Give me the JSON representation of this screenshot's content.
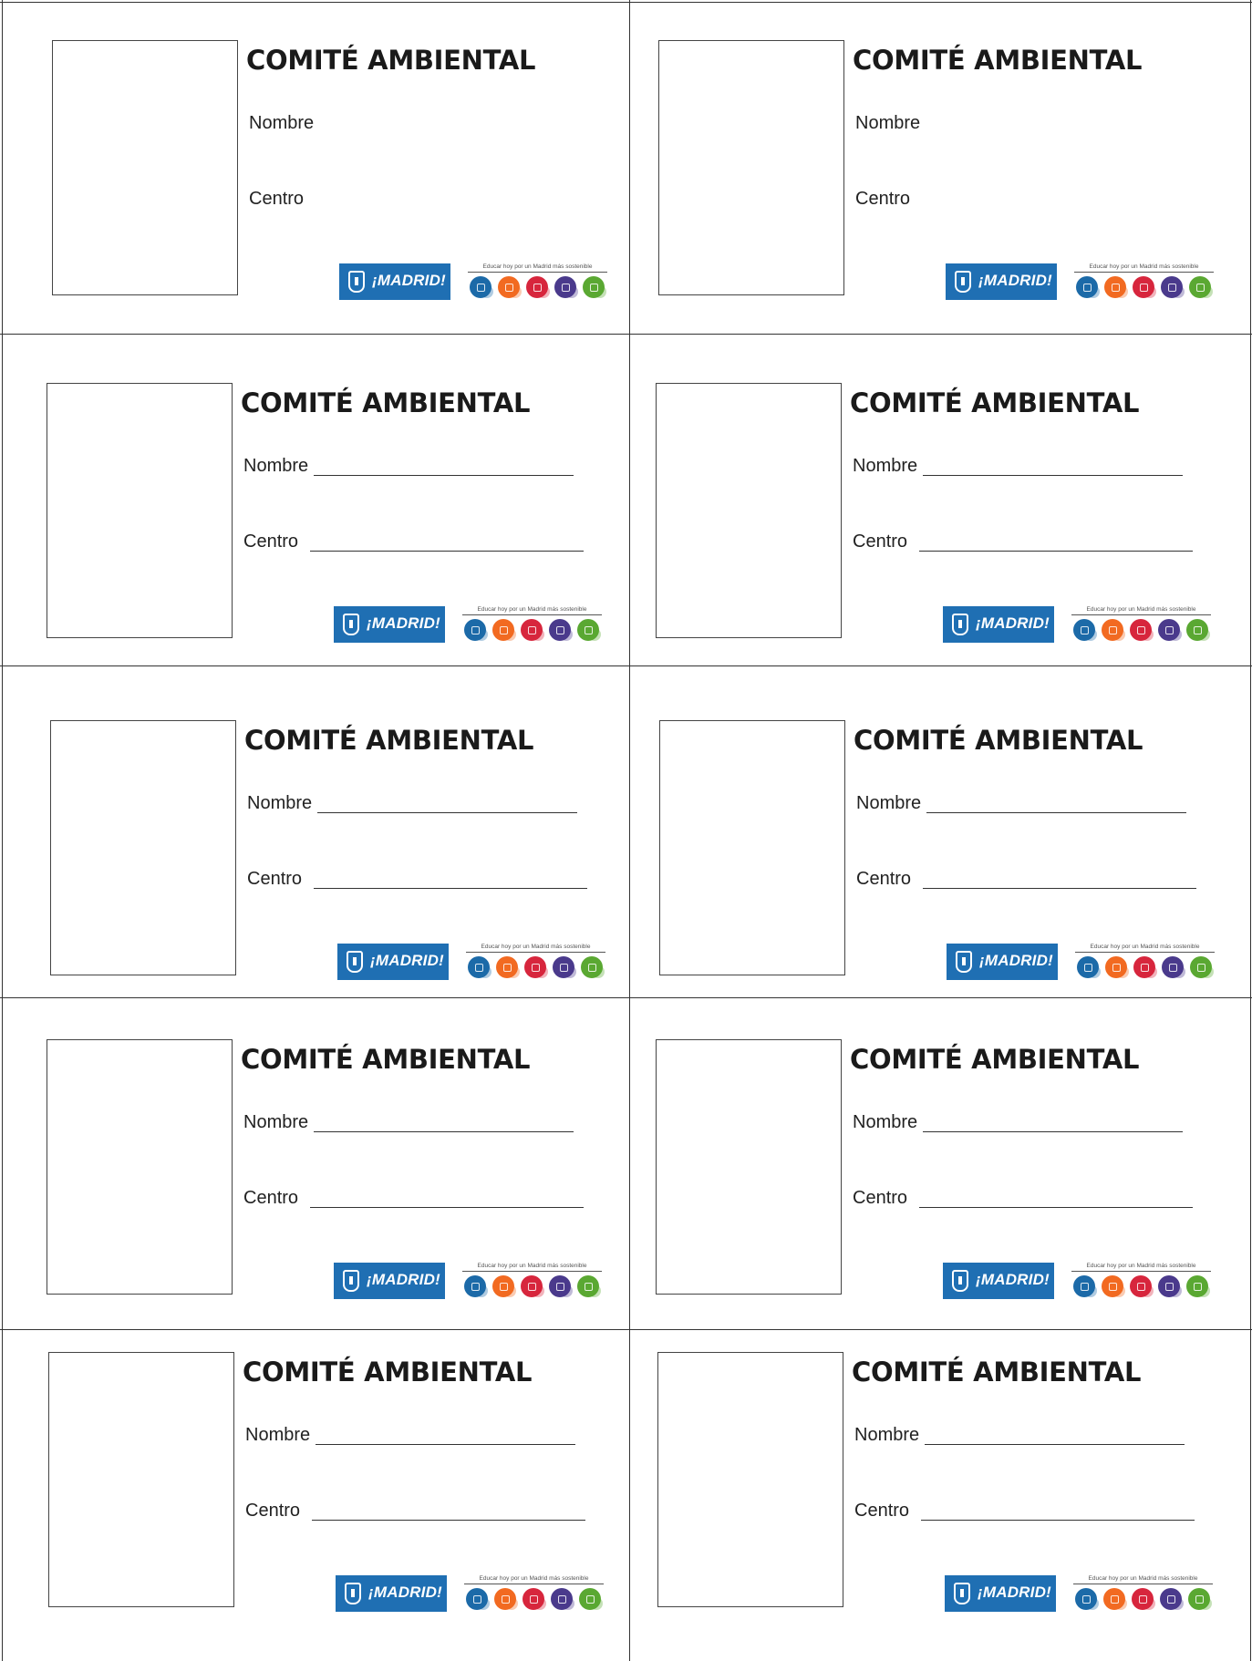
{
  "document": {
    "cards": [
      {
        "title": "COMITÉ AMBIENTAL",
        "name_label": "Nombre",
        "center_label": "Centro",
        "has_lines": false,
        "logo_text": "¡MADRID!",
        "tagline": "Educar hoy por un Madrid más sostenible"
      },
      {
        "title": "COMITÉ AMBIENTAL",
        "name_label": "Nombre",
        "center_label": "Centro",
        "has_lines": false,
        "logo_text": "¡MADRID!",
        "tagline": "Educar hoy por un Madrid más sostenible"
      },
      {
        "title": "COMITÉ AMBIENTAL",
        "name_label": "Nombre",
        "center_label": "Centro",
        "has_lines": true,
        "logo_text": "¡MADRID!",
        "tagline": "Educar hoy por un Madrid más sostenible"
      },
      {
        "title": "COMITÉ AMBIENTAL",
        "name_label": "Nombre",
        "center_label": "Centro",
        "has_lines": true,
        "logo_text": "¡MADRID!",
        "tagline": "Educar hoy por un Madrid más sostenible"
      },
      {
        "title": "COMITÉ AMBIENTAL",
        "name_label": "Nombre",
        "center_label": "Centro",
        "has_lines": true,
        "logo_text": "¡MADRID!",
        "tagline": "Educar hoy por un Madrid más sostenible"
      },
      {
        "title": "COMITÉ AMBIENTAL",
        "name_label": "Nombre",
        "center_label": "Centro",
        "has_lines": true,
        "logo_text": "¡MADRID!",
        "tagline": "Educar hoy por un Madrid más sostenible"
      },
      {
        "title": "COMITÉ AMBIENTAL",
        "name_label": "Nombre",
        "center_label": "Centro",
        "has_lines": true,
        "logo_text": "¡MADRID!",
        "tagline": "Educar hoy por un Madrid más sostenible"
      },
      {
        "title": "COMITÉ AMBIENTAL",
        "name_label": "Nombre",
        "center_label": "Centro",
        "has_lines": true,
        "logo_text": "¡MADRID!",
        "tagline": "Educar hoy por un Madrid más sostenible"
      },
      {
        "title": "COMITÉ AMBIENTAL",
        "name_label": "Nombre",
        "center_label": "Centro",
        "has_lines": true,
        "logo_text": "¡MADRID!",
        "tagline": "Educar hoy por un Madrid más sostenible"
      },
      {
        "title": "COMITÉ AMBIENTAL",
        "name_label": "Nombre",
        "center_label": "Centro",
        "has_lines": true,
        "logo_text": "¡MADRID!",
        "tagline": "Educar hoy por un Madrid más sostenible"
      }
    ],
    "colors": {
      "madrid_blue": "#1f6fb3",
      "dot_colors": [
        "#1c6aa8",
        "#f26a21",
        "#d7263d",
        "#4a3a8c",
        "#5aa832"
      ]
    }
  }
}
